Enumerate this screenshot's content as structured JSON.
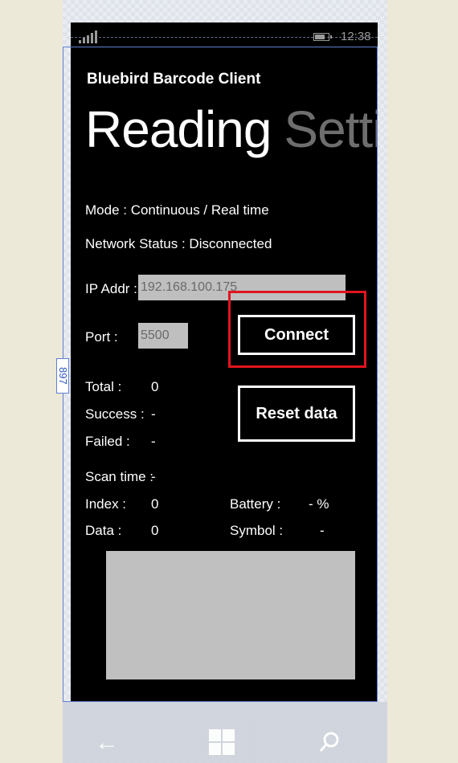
{
  "statusbar": {
    "time": "12:38",
    "icons": [
      "signal-icon",
      "battery-icon"
    ]
  },
  "app": {
    "title": "Bluebird Barcode Client"
  },
  "pivot": {
    "active": "Reading",
    "inactive": "Setting"
  },
  "info": {
    "mode": "Mode :  Continuous / Real time",
    "network": "Network Status : Disconnected"
  },
  "ip": {
    "label": "IP Addr :",
    "value": "192.168.100.175"
  },
  "port": {
    "label": "Port :",
    "value": "5500"
  },
  "buttons": {
    "connect": "Connect",
    "reset": "Reset data"
  },
  "stats": {
    "total_label": "Total :",
    "total_value": "0",
    "success_label": "Success :",
    "success_value": "-",
    "failed_label": "Failed :",
    "failed_value": "-",
    "scan_time_label": "Scan time :",
    "scan_time_value": "-",
    "index_label": "Index :",
    "index_value": "0",
    "data_label": "Data :",
    "data_value": "0",
    "battery_label": "Battery :",
    "battery_value": "- %",
    "symbol_label": "Symbol :",
    "symbol_value": "-"
  },
  "designer": {
    "height_label": "897"
  },
  "colors": {
    "highlight": "#e0141e",
    "field_bg": "#bfbfbf",
    "background": "#000000"
  }
}
